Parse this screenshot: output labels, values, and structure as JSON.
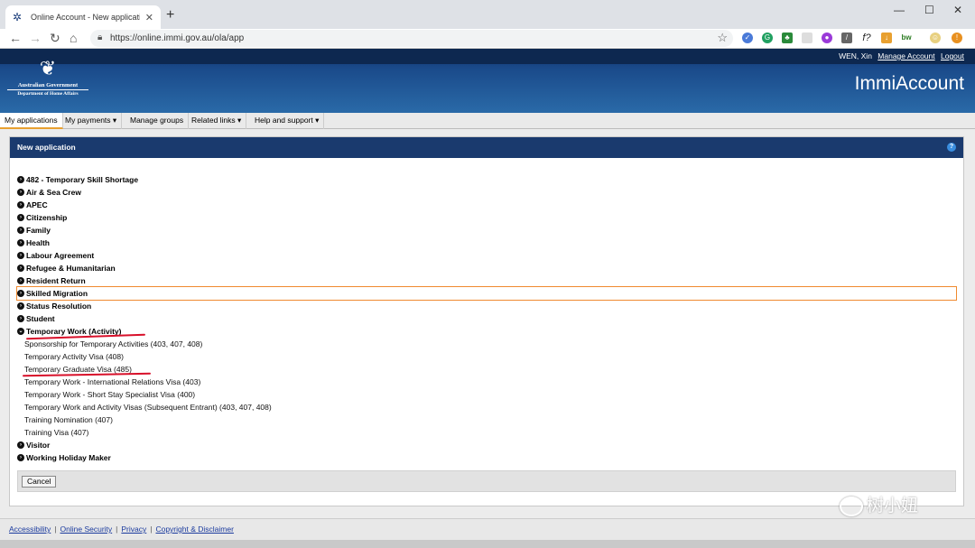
{
  "browser": {
    "tab_title": "Online Account - New applicatio",
    "url": "https://online.immi.gov.au/ola/app"
  },
  "header": {
    "user_name": "WEN, Xin",
    "manage_account": "Manage Account",
    "logout": "Logout",
    "gov_line1": "Australian Government",
    "gov_line2": "Department of Home Affairs",
    "app_name": "ImmiAccount"
  },
  "menu": {
    "items": [
      {
        "label": "My applications"
      },
      {
        "label": "My payments ▾"
      },
      {
        "label": "Manage groups"
      },
      {
        "label": "Related links ▾"
      },
      {
        "label": "Help and support ▾"
      }
    ]
  },
  "panel": {
    "title": "New application",
    "categories_top": [
      "482 - Temporary Skill Shortage",
      "Air & Sea Crew",
      "APEC",
      "Citizenship",
      "Family",
      "Health",
      "Labour Agreement",
      "Refugee & Humanitarian",
      "Resident Return",
      "Skilled Migration",
      "Status Resolution",
      "Student"
    ],
    "expanded_category": "Temporary Work (Activity)",
    "sub_items": [
      "Sponsorship for Temporary Activities (403, 407, 408)",
      "Temporary Activity Visa (408)",
      "Temporary Graduate Visa (485)",
      "Temporary Work - International Relations Visa (403)",
      "Temporary Work - Short Stay Specialist Visa (400)",
      "Temporary Work and Activity Visas (Subsequent Entrant) (403, 407, 408)",
      "Training Nomination (407)",
      "Training Visa (407)"
    ],
    "categories_bottom": [
      "Visitor",
      "Working Holiday Maker"
    ],
    "cancel_label": "Cancel"
  },
  "footer": {
    "links": [
      "Accessibility",
      "Online Security",
      "Privacy",
      "Copyright & Disclaimer"
    ]
  },
  "watermark": "树小妞"
}
